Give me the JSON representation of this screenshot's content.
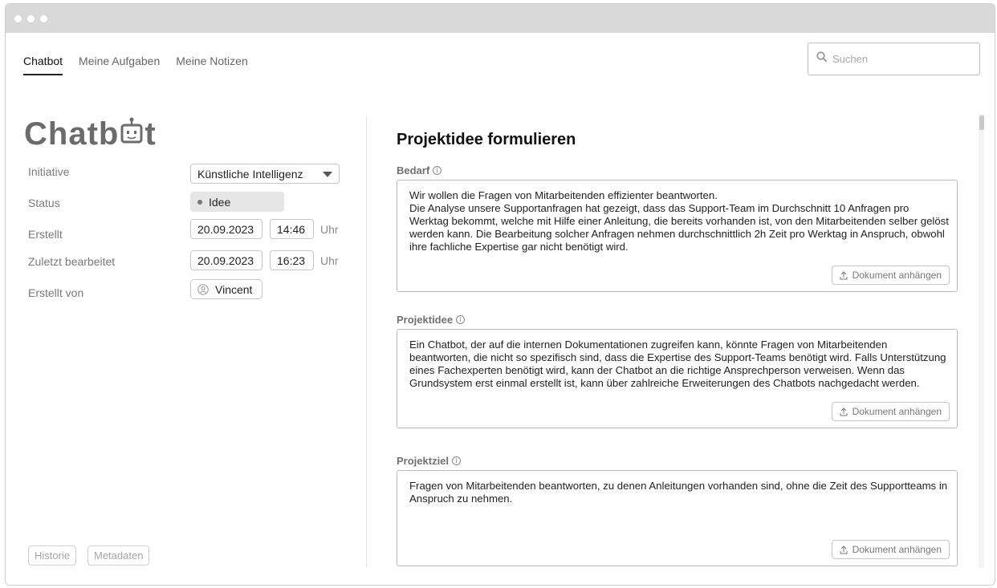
{
  "window": {
    "dots": [
      "dot-1",
      "dot-2",
      "dot-3"
    ]
  },
  "nav": {
    "tabs": [
      {
        "label": "Chatbot",
        "active": true
      },
      {
        "label": "Meine Aufgaben",
        "active": false
      },
      {
        "label": "Meine Notizen",
        "active": false
      }
    ]
  },
  "search": {
    "placeholder": "Suchen",
    "icon": "search-icon"
  },
  "project": {
    "title_part1": "Chatb",
    "title_part2": "t",
    "title_icon": "robot-icon",
    "fields": {
      "initiative_label": "Initiative",
      "initiative_value": "Künstliche Intelligenz",
      "status_label": "Status",
      "status_value": "Idee",
      "created_label": "Erstellt",
      "created_date": "20.09.2023",
      "created_time": "14:46",
      "edited_label": "Zuletzt bearbeitet",
      "edited_date": "20.09.2023",
      "edited_time": "16:23",
      "time_unit": "Uhr",
      "author_label": "Erstellt von",
      "author_value": "Vincent"
    },
    "bottom_buttons": {
      "history": "Historie",
      "metadata": "Metadaten"
    }
  },
  "main": {
    "heading": "Projektidee formulieren",
    "attach_label": "Dokument anhängen",
    "sections": [
      {
        "label": "Bedarf",
        "text": "Wir wollen die Fragen von Mitarbeitenden effizienter beantworten.\nDie Analyse unsere Supportanfragen hat gezeigt, dass das Support-Team im Durchschnitt 10 Anfragen pro Werktag bekommt, welche mit Hilfe einer Anleitung, die bereits vorhanden ist, von den Mitarbeitenden selber gelöst werden kann. Die Bearbeitung solcher Anfragen nehmen durchschnittlich 2h Zeit pro Werktag in Anspruch, obwohl ihre fachliche Expertise gar nicht benötigt wird."
      },
      {
        "label": "Projektidee",
        "text": "Ein Chatbot, der auf die internen Dokumentationen zugreifen kann, könnte Fragen von Mitarbeitenden beantworten, die nicht so spezifisch sind, dass die Expertise des Support-Teams benötigt wird. Falls Unterstützung eines Fachexperten benötigt wird, kann der Chatbot an die richtige Ansprechperson verweisen. Wenn das Grundsystem erst einmal erstellt ist, kann über zahlreiche Erweiterungen des Chatbots nachgedacht werden."
      },
      {
        "label": "Projektziel",
        "text": "Fragen von Mitarbeitenden beantworten, zu denen Anleitungen vorhanden sind, ohne die Zeit des Supportteams in Anspruch zu nehmen."
      }
    ]
  },
  "colors": {
    "title_gray": "#6b6b6b",
    "status_bg": "#e6e6e6",
    "titlebar": "#d9d9d9"
  }
}
